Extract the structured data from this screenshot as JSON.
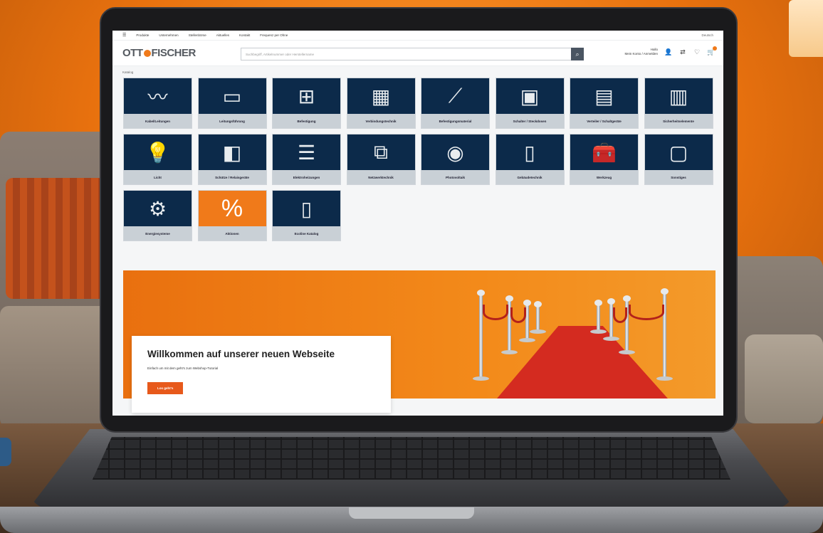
{
  "topbar": {
    "menu_label": "Produkte",
    "links": [
      "Unternehmen",
      "Stellenbörse",
      "Aktuelles",
      "Kontakt",
      "Frequenz per Ohne"
    ],
    "language": "Deutsch"
  },
  "header": {
    "logo_left": "OTT",
    "logo_right": "FISCHER",
    "search_placeholder": "Suchbegriff, Artikelnummer oder Herstellername",
    "account_line1": "Hallo",
    "account_line2": "Mein Konto / Anmelden"
  },
  "breadcrumb": "Katalog",
  "categories": [
    {
      "label": "Kabel/Leitungen",
      "icon": "cable"
    },
    {
      "label": "Leitungsführung",
      "icon": "duct"
    },
    {
      "label": "Befestigung",
      "icon": "clamp"
    },
    {
      "label": "Verbindungstechnik",
      "icon": "connector"
    },
    {
      "label": "Befestigungsmaterial",
      "icon": "screw"
    },
    {
      "label": "Schalter / Steckdosen",
      "icon": "socket"
    },
    {
      "label": "Verteiler / Schaltgeräte",
      "icon": "cabinet"
    },
    {
      "label": "Sicherheitselemente",
      "icon": "breaker"
    },
    {
      "label": "Licht",
      "icon": "bulb"
    },
    {
      "label": "Schütze / Relaisgeräte",
      "icon": "switch-device"
    },
    {
      "label": "Elektroheizungen",
      "icon": "radiator"
    },
    {
      "label": "Netzwerktechnik",
      "icon": "network-plug"
    },
    {
      "label": "Photovoltaik",
      "icon": "pv-device"
    },
    {
      "label": "Gebäudetechnik",
      "icon": "intercom"
    },
    {
      "label": "Werkzeug",
      "icon": "toolbox"
    },
    {
      "label": "Sonstiges",
      "icon": "meter"
    },
    {
      "label": "Energiesysteme",
      "icon": "gears"
    },
    {
      "label": "Aktionen",
      "icon": "percent"
    },
    {
      "label": "Ecoline Katalog",
      "icon": "box"
    }
  ],
  "hero": {
    "title": "Willkommen auf unserer neuen Webseite",
    "subtitle": "Einfach um mit dem geht's zum Webshop-Tutorial",
    "button": "Los geht's"
  },
  "colors": {
    "accent": "#f07a1a",
    "tile_bg": "#0c2a4a",
    "tile_label_bg": "#c9d0d6",
    "cta": "#e7591b"
  }
}
